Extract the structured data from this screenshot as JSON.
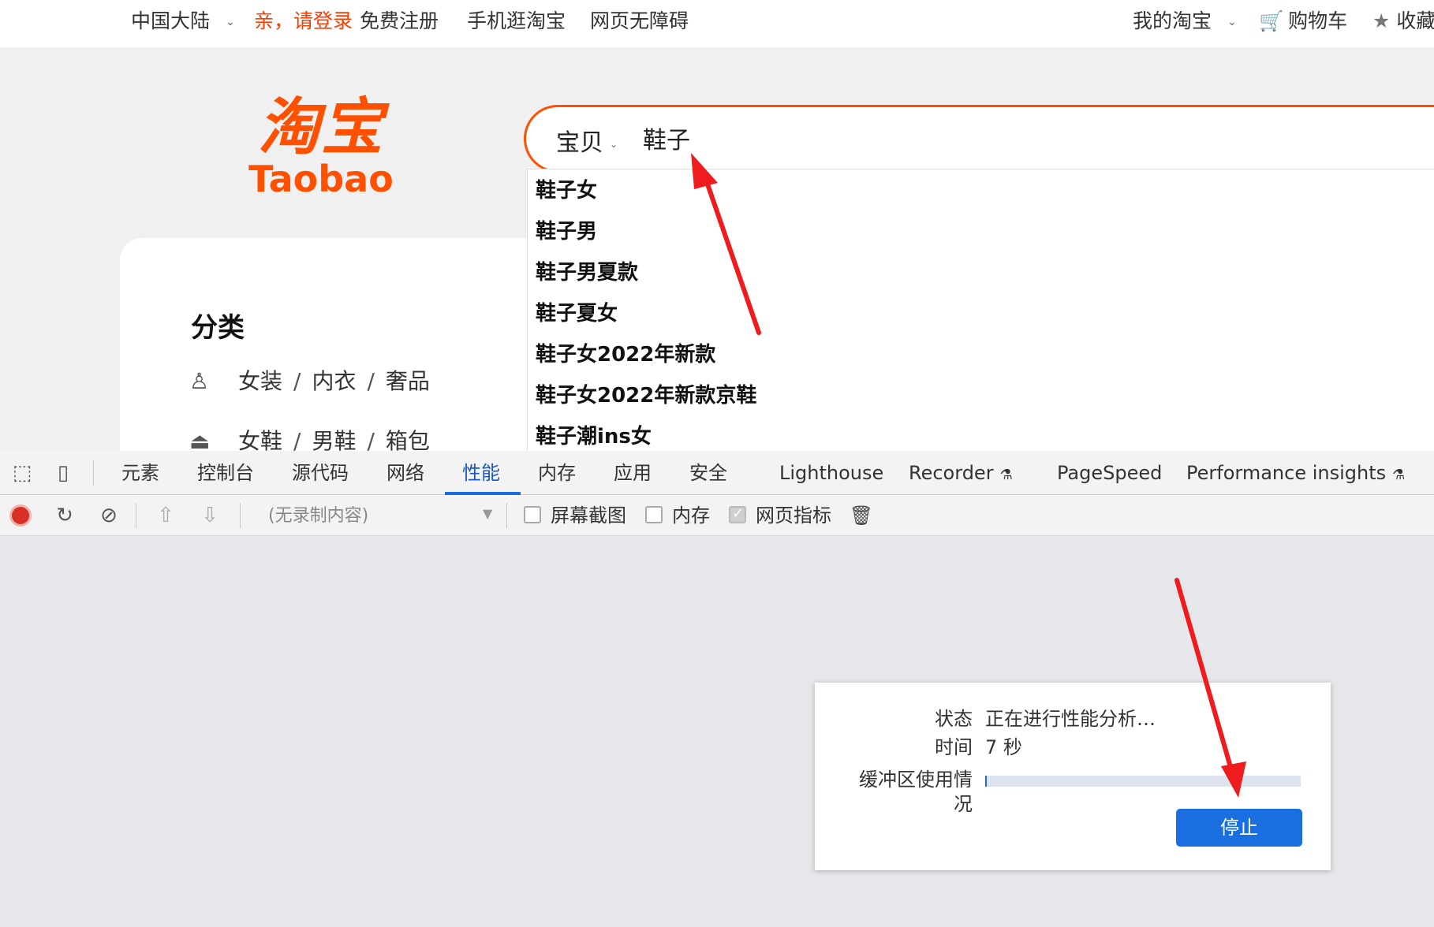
{
  "topbar": {
    "region": "中国大陆",
    "login": "亲，请登录",
    "register": "免费注册",
    "mobile": "手机逛淘宝",
    "accessibility": "网页无障碍",
    "my_taobao": "我的淘宝",
    "cart": "购物车",
    "favorites": "收藏"
  },
  "logo": {
    "cn": "淘宝",
    "en": "Taobao"
  },
  "search": {
    "category": "宝贝",
    "value": "鞋子",
    "suggestions": [
      "鞋子女",
      "鞋子男",
      "鞋子男夏款",
      "鞋子夏女",
      "鞋子女2022年新款",
      "鞋子女2022年新款京鞋",
      "鞋子潮ins女"
    ]
  },
  "categories": {
    "title": "分类",
    "rows": [
      [
        "女装",
        "内衣",
        "奢品"
      ],
      [
        "女鞋",
        "男鞋",
        "箱包"
      ]
    ]
  },
  "devtools": {
    "tabs": [
      "元素",
      "控制台",
      "源代码",
      "网络",
      "性能",
      "内存",
      "应用",
      "安全",
      "Lighthouse",
      "Recorder",
      "PageSpeed",
      "Performance insights"
    ],
    "active_tab": "性能",
    "toolbar": {
      "profile_placeholder": "(无录制内容)",
      "screenshot_label": "屏幕截图",
      "memory_label": "内存",
      "web_vitals_label": "网页指标"
    },
    "status": {
      "status_label": "状态",
      "status_value": "正在进行性能分析…",
      "time_label": "时间",
      "time_value": "7 秒",
      "buffer_label": "缓冲区使用情况",
      "buffer_usage_fraction": 0.005,
      "stop_label": "停止"
    }
  },
  "colors": {
    "taobao_orange": "#ff5000",
    "login_red": "#ff3c00",
    "devtools_blue": "#1a6fe0",
    "record_red": "#d93025",
    "annotation_red": "#ee1c1c"
  }
}
